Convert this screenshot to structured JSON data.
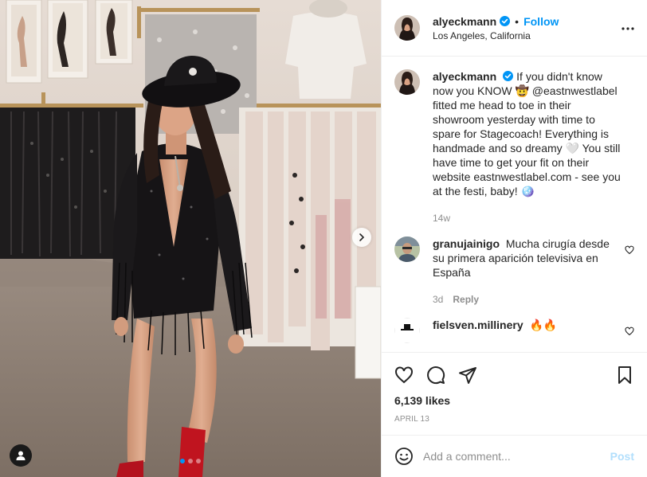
{
  "header": {
    "username": "alyeckmann",
    "verified_icon": "verified-badge-icon",
    "bullet": "•",
    "follow_label": "Follow",
    "location": "Los Angeles, California",
    "more_icon": "more-options-icon"
  },
  "caption": {
    "username": "alyeckmann",
    "text": "If you didn't know now you KNOW 🤠 @eastnwestlabel fitted me head to toe in their showroom yesterday with time to spare for Stagecoach! Everything is handmade and so dreamy 🤍 You still have time to get your fit on their website eastnwestlabel.com - see you at the festi, baby! 🪩",
    "time": "14w"
  },
  "comments": [
    {
      "username": "granujainigo",
      "text": "Mucha cirugía desde su primera aparición televisiva en España",
      "time": "3d",
      "reply_label": "Reply"
    },
    {
      "username": "fielsven.millinery",
      "text": "🔥🔥"
    }
  ],
  "actions": {
    "likes": "6,139 likes",
    "date": "APRIL 13"
  },
  "composer": {
    "placeholder": "Add a comment...",
    "post_label": "Post"
  },
  "carousel": {
    "slide_count": 3,
    "active_slide": 1
  },
  "colors": {
    "accent": "#0095f6",
    "text": "#262626",
    "muted": "#8e8e8e",
    "post_disabled": "#b2dffc",
    "border": "#efefef"
  }
}
